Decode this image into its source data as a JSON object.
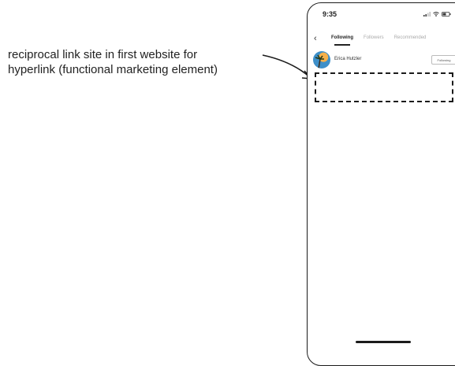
{
  "annotation": {
    "line1": "reciprocal link site in first website for",
    "line2": "hyperlink (functional marketing element)"
  },
  "status_bar": {
    "time": "9:35",
    "icons": [
      "signal-icon",
      "wifi-icon",
      "battery-icon"
    ]
  },
  "nav": {
    "back_icon": "chevron-left-icon",
    "tabs": [
      {
        "label": "Following",
        "active": true
      },
      {
        "label": "Followers",
        "active": false
      },
      {
        "label": "Recommended",
        "active": false
      }
    ]
  },
  "user_list": [
    {
      "name": "Erica Hutzler",
      "button_label": "Following"
    }
  ]
}
